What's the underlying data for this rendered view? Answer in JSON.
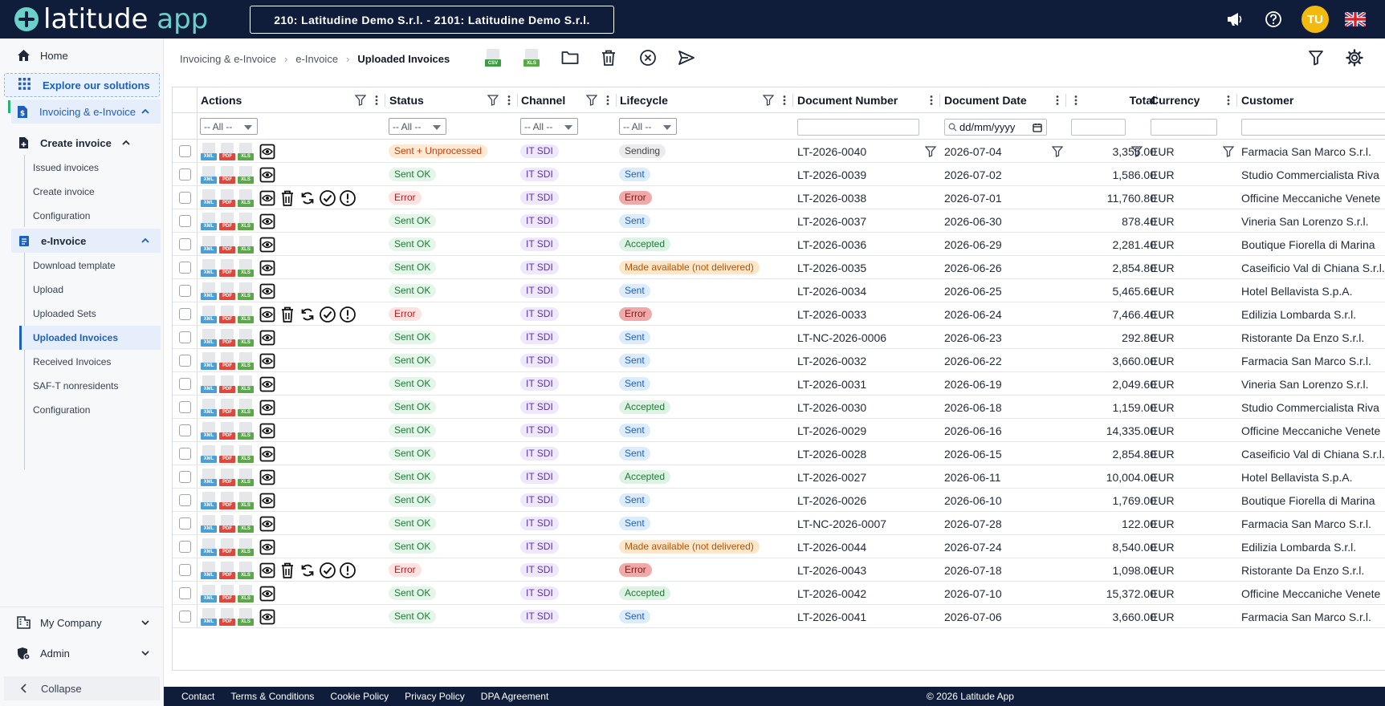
{
  "app": {
    "logo_word1": "latitude",
    "logo_word2": "app",
    "company": "210: Latitudine Demo S.r.l. - 2101: Latitudine Demo S.r.l.",
    "user_initials": "TU"
  },
  "sidebar": {
    "home": "Home",
    "explore": "Explore our solutions",
    "invoicing": "Invoicing & e-Invoice",
    "create_invoice_group": "Create invoice",
    "create_items": [
      "Issued invoices",
      "Create invoice",
      "Configuration"
    ],
    "einvoice_group": "e-Invoice",
    "einvoice_items": [
      "Download template",
      "Upload",
      "Uploaded Sets",
      "Uploaded Invoices",
      "Received Invoices",
      "SAF-T nonresidents",
      "Configuration"
    ],
    "my_company": "My Company",
    "admin": "Admin",
    "collapse": "Collapse"
  },
  "breadcrumb": {
    "level1": "Invoicing & e-Invoice",
    "level2": "e-Invoice",
    "current": "Uploaded Invoices"
  },
  "toolbar": {
    "csv_tag": "CSV",
    "xls_tag": "XLS"
  },
  "grid": {
    "headers": {
      "actions": "Actions",
      "status": "Status",
      "channel": "Channel",
      "lifecycle": "Lifecycle",
      "doc_number": "Document Number",
      "doc_date": "Document Date",
      "total": "Total",
      "currency": "Currency",
      "customer": "Customer"
    },
    "filter_all": "-- All --",
    "date_placeholder": "dd/mm/yyyy",
    "file_tags": {
      "xml": "XML",
      "pdf": "PDF",
      "xls": "XLS"
    },
    "rows": [
      {
        "status": "Sent + Unprocessed",
        "channel": "IT SDI",
        "lifecycle": "Sending",
        "number": "LT-2026-0040",
        "date": "2026-07-04",
        "total": "3,355.00",
        "currency": "EUR",
        "customer": "Farmacia San Marco S.r.l."
      },
      {
        "status": "Sent OK",
        "channel": "IT SDI",
        "lifecycle": "Sent",
        "number": "LT-2026-0039",
        "date": "2026-07-02",
        "total": "1,586.00",
        "currency": "EUR",
        "customer": "Studio Commercialista Riva"
      },
      {
        "status": "Error",
        "channel": "IT SDI",
        "lifecycle": "Error",
        "number": "LT-2026-0038",
        "date": "2026-07-01",
        "total": "11,760.80",
        "currency": "EUR",
        "customer": "Officine Meccaniche Venete"
      },
      {
        "status": "Sent OK",
        "channel": "IT SDI",
        "lifecycle": "Sent",
        "number": "LT-2026-0037",
        "date": "2026-06-30",
        "total": "878.40",
        "currency": "EUR",
        "customer": "Vineria San Lorenzo S.r.l."
      },
      {
        "status": "Sent OK",
        "channel": "IT SDI",
        "lifecycle": "Accepted",
        "number": "LT-2026-0036",
        "date": "2026-06-29",
        "total": "2,281.40",
        "currency": "EUR",
        "customer": "Boutique Fiorella di Marina"
      },
      {
        "status": "Sent OK",
        "channel": "IT SDI",
        "lifecycle": "Made available (not delivered)",
        "number": "LT-2026-0035",
        "date": "2026-06-26",
        "total": "2,854.80",
        "currency": "EUR",
        "customer": "Caseificio Val di Chiana S.r.l."
      },
      {
        "status": "Sent OK",
        "channel": "IT SDI",
        "lifecycle": "Sent",
        "number": "LT-2026-0034",
        "date": "2026-06-25",
        "total": "5,465.60",
        "currency": "EUR",
        "customer": "Hotel Bellavista S.p.A."
      },
      {
        "status": "Error",
        "channel": "IT SDI",
        "lifecycle": "Error",
        "number": "LT-2026-0033",
        "date": "2026-06-24",
        "total": "7,466.40",
        "currency": "EUR",
        "customer": "Edilizia Lombarda S.r.l."
      },
      {
        "status": "Sent OK",
        "channel": "IT SDI",
        "lifecycle": "Sent",
        "number": "LT-NC-2026-0006",
        "date": "2026-06-23",
        "total": "292.80",
        "currency": "EUR",
        "customer": "Ristorante Da Enzo S.r.l."
      },
      {
        "status": "Sent OK",
        "channel": "IT SDI",
        "lifecycle": "Sent",
        "number": "LT-2026-0032",
        "date": "2026-06-22",
        "total": "3,660.00",
        "currency": "EUR",
        "customer": "Farmacia San Marco S.r.l."
      },
      {
        "status": "Sent OK",
        "channel": "IT SDI",
        "lifecycle": "Sent",
        "number": "LT-2026-0031",
        "date": "2026-06-19",
        "total": "2,049.60",
        "currency": "EUR",
        "customer": "Vineria San Lorenzo S.r.l."
      },
      {
        "status": "Sent OK",
        "channel": "IT SDI",
        "lifecycle": "Accepted",
        "number": "LT-2026-0030",
        "date": "2026-06-18",
        "total": "1,159.00",
        "currency": "EUR",
        "customer": "Studio Commercialista Riva"
      },
      {
        "status": "Sent OK",
        "channel": "IT SDI",
        "lifecycle": "Sent",
        "number": "LT-2026-0029",
        "date": "2026-06-16",
        "total": "14,335.00",
        "currency": "EUR",
        "customer": "Officine Meccaniche Venete"
      },
      {
        "status": "Sent OK",
        "channel": "IT SDI",
        "lifecycle": "Sent",
        "number": "LT-2026-0028",
        "date": "2026-06-15",
        "total": "2,854.80",
        "currency": "EUR",
        "customer": "Caseificio Val di Chiana S.r.l."
      },
      {
        "status": "Sent OK",
        "channel": "IT SDI",
        "lifecycle": "Accepted",
        "number": "LT-2026-0027",
        "date": "2026-06-11",
        "total": "10,004.00",
        "currency": "EUR",
        "customer": "Hotel Bellavista S.p.A."
      },
      {
        "status": "Sent OK",
        "channel": "IT SDI",
        "lifecycle": "Sent",
        "number": "LT-2026-0026",
        "date": "2026-06-10",
        "total": "1,769.00",
        "currency": "EUR",
        "customer": "Boutique Fiorella di Marina"
      },
      {
        "status": "Sent OK",
        "channel": "IT SDI",
        "lifecycle": "Sent",
        "number": "LT-NC-2026-0007",
        "date": "2026-07-28",
        "total": "122.00",
        "currency": "EUR",
        "customer": "Farmacia San Marco S.r.l."
      },
      {
        "status": "Sent OK",
        "channel": "IT SDI",
        "lifecycle": "Made available (not delivered)",
        "number": "LT-2026-0044",
        "date": "2026-07-24",
        "total": "8,540.00",
        "currency": "EUR",
        "customer": "Edilizia Lombarda S.r.l."
      },
      {
        "status": "Error",
        "channel": "IT SDI",
        "lifecycle": "Error",
        "number": "LT-2026-0043",
        "date": "2026-07-18",
        "total": "1,098.00",
        "currency": "EUR",
        "customer": "Ristorante Da Enzo S.r.l."
      },
      {
        "status": "Sent OK",
        "channel": "IT SDI",
        "lifecycle": "Accepted",
        "number": "LT-2026-0042",
        "date": "2026-07-10",
        "total": "15,372.00",
        "currency": "EUR",
        "customer": "Officine Meccaniche Venete"
      },
      {
        "status": "Sent OK",
        "channel": "IT SDI",
        "lifecycle": "Sent",
        "number": "LT-2026-0041",
        "date": "2026-07-06",
        "total": "3,660.00",
        "currency": "EUR",
        "customer": "Farmacia San Marco S.r.l."
      }
    ]
  },
  "footer": {
    "links": [
      "Contact",
      "Terms & Conditions",
      "Cookie Policy",
      "Privacy Policy",
      "DPA Agreement"
    ],
    "copyright": "© 2026 Latitude App"
  },
  "colors": {
    "topbar": "#0f1d3a",
    "accent": "#1d5fbf",
    "logo_teal": "#6ad0c8",
    "avatar": "#f2b90f"
  }
}
